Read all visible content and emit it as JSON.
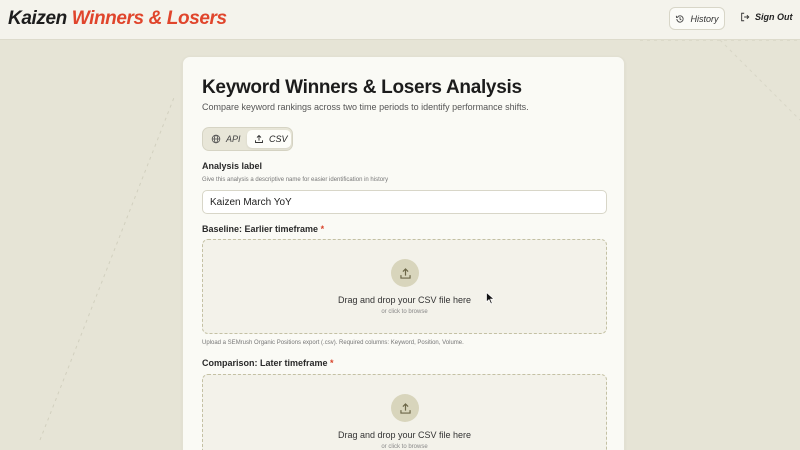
{
  "header": {
    "brand_part1": "Kaizen",
    "brand_part2": "Winners & Losers",
    "history_label": "History",
    "signout_label": "Sign Out"
  },
  "page": {
    "title": "Keyword Winners & Losers Analysis",
    "subtitle": "Compare keyword rankings across two time periods to identify performance shifts."
  },
  "source_toggle": {
    "options": [
      {
        "label": "API",
        "icon": "globe-icon",
        "selected": false
      },
      {
        "label": "CSV",
        "icon": "upload-icon",
        "selected": true
      }
    ]
  },
  "analysis_label": {
    "label": "Analysis label",
    "hint": "Give this analysis a descriptive name for easier identification in history",
    "value": "Kaizen March YoY"
  },
  "baseline": {
    "label": "Baseline: Earlier timeframe",
    "required_mark": "*",
    "drop_text": "Drag and drop your CSV file here",
    "browse_text": "or click to browse",
    "help": "Upload a SEMrush Organic Positions export (.csv). Required columns: Keyword, Position, Volume."
  },
  "comparison": {
    "label": "Comparison: Later timeframe",
    "required_mark": "*",
    "drop_text": "Drag and drop your CSV file here",
    "browse_text": "or click to browse"
  },
  "colors": {
    "accent": "#e0452c",
    "background": "#e6e4d6",
    "card": "#fafaf5",
    "upload_circle": "#d8d5bc"
  }
}
